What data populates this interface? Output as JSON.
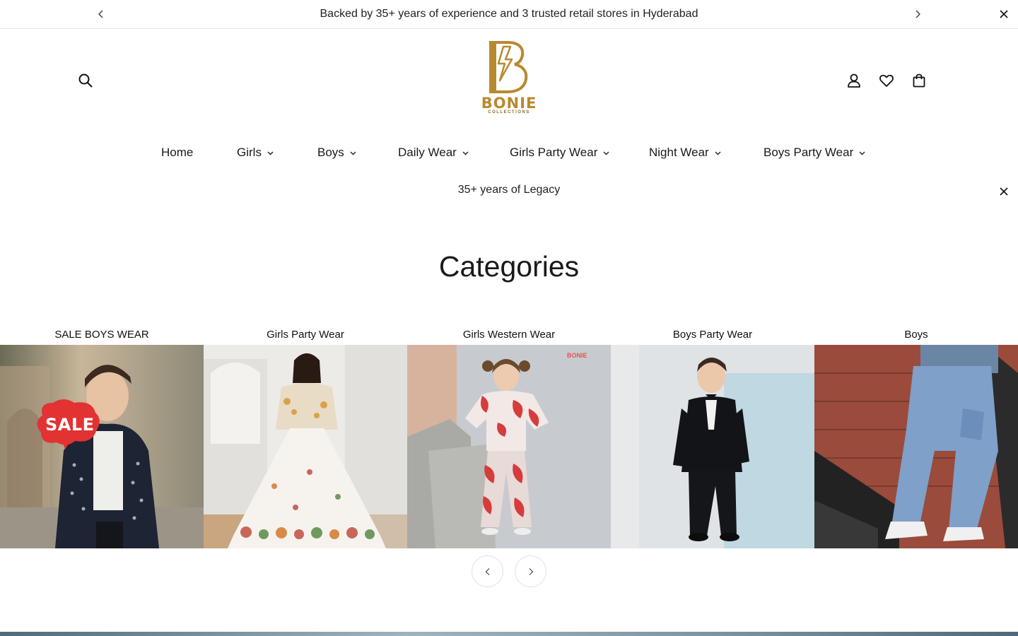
{
  "announcement": {
    "text": "Backed by 35+ years of experience and 3 trusted retail stores in Hyderabad"
  },
  "brand": {
    "name": "BONIE",
    "tagline": "COLLECTIONS",
    "color": "#b8892f"
  },
  "nav": {
    "items": [
      {
        "label": "Home",
        "dropdown": false
      },
      {
        "label": "Girls",
        "dropdown": true
      },
      {
        "label": "Boys",
        "dropdown": true
      },
      {
        "label": "Daily Wear",
        "dropdown": true
      },
      {
        "label": "Girls Party Wear",
        "dropdown": true
      },
      {
        "label": "Night Wear",
        "dropdown": true
      },
      {
        "label": "Boys Party Wear",
        "dropdown": true
      }
    ]
  },
  "secondary_banner": {
    "text": "35+ years of Legacy"
  },
  "categories": {
    "title": "Categories",
    "items": [
      {
        "label": "SALE BOYS WEAR",
        "badge": "SALE"
      },
      {
        "label": "Girls Party Wear"
      },
      {
        "label": "Girls Western Wear",
        "watermark": "BONIE"
      },
      {
        "label": "Boys Party Wear"
      },
      {
        "label": "Boys"
      }
    ]
  },
  "icons": {
    "search": "search-icon",
    "account": "user-icon",
    "wishlist": "heart-icon",
    "cart": "shopping-bag-icon"
  }
}
